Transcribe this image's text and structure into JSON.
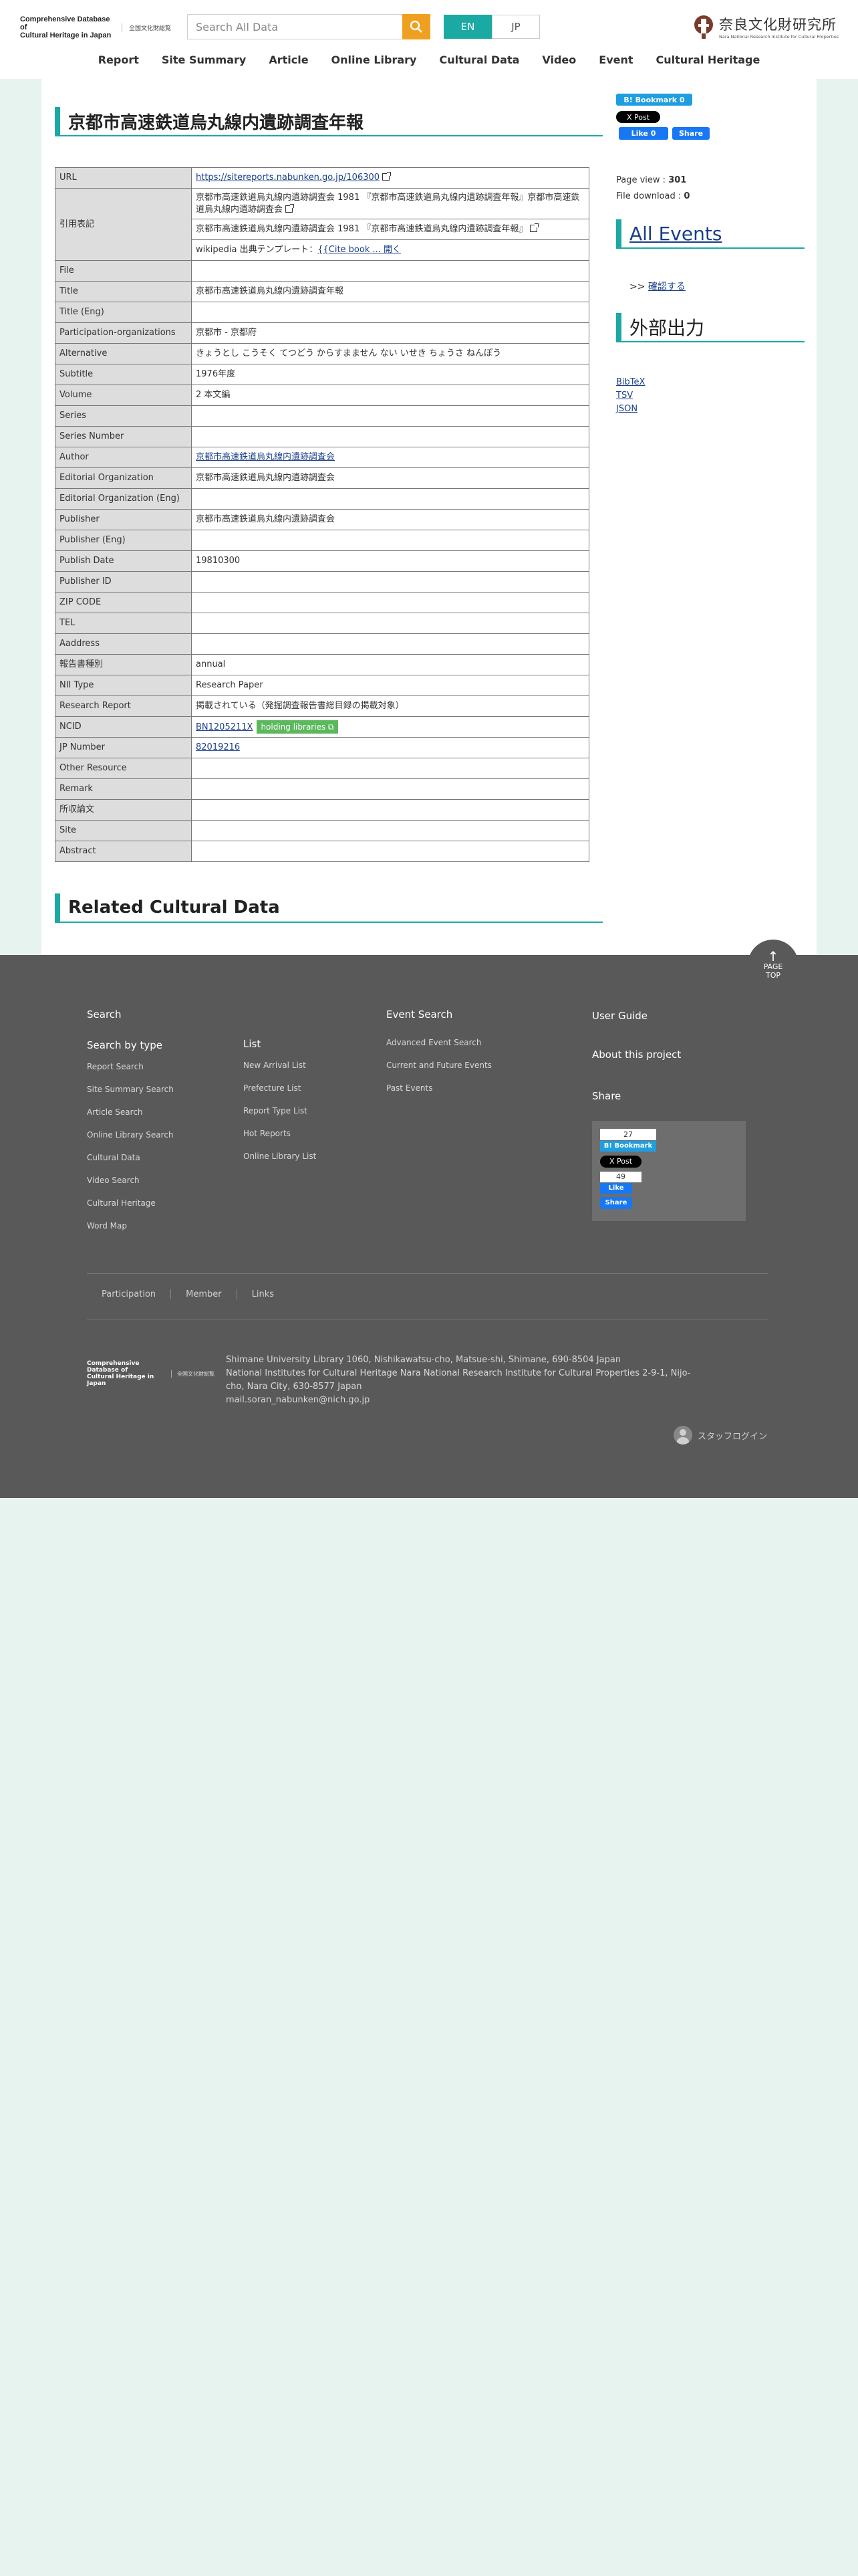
{
  "header": {
    "logo_en_line1": "Comprehensive Database of",
    "logo_en_line2": "Cultural Heritage in Japan",
    "logo_jp": "全国文化財総覧",
    "search_placeholder": "Search All Data",
    "lang_en": "EN",
    "lang_jp": "JP",
    "org_name": "奈良文化財研究所",
    "org_name_en": "Nara National Research Institute for Cultural Properties"
  },
  "nav": [
    "Report",
    "Site Summary",
    "Article",
    "Online Library",
    "Cultural Data",
    "Video",
    "Event",
    "Cultural Heritage"
  ],
  "page_title": "京都市高速鉄道烏丸線内遺跡調査年報",
  "metadata": {
    "url_label": "URL",
    "url_value": "https://sitereports.nabunken.go.jp/106300",
    "citation_label": "引用表記",
    "citation_1": "京都市高速鉄道烏丸線内遺跡調査会 1981 『京都市高速鉄道烏丸線内遺跡調査年報』京都市高速鉄道烏丸線内遺跡調査会",
    "citation_2": "京都市高速鉄道烏丸線内遺跡調査会 1981 『京都市高速鉄道烏丸線内遺跡調査年報』",
    "citation_3_prefix": "wikipedia 出典テンプレート：",
    "citation_3_link": "{{Cite book ... 開く",
    "rows": [
      {
        "label": "File",
        "value": ""
      },
      {
        "label": "Title",
        "value": "京都市高速鉄道烏丸線内遺跡調査年報"
      },
      {
        "label": "Title (Eng)",
        "value": ""
      },
      {
        "label": "Participation-organizations",
        "value": "京都市 - 京都府"
      },
      {
        "label": "Alternative",
        "value": "きょうとし こうそく てつどう からすまません ない いせき ちょうさ ねんぽう"
      },
      {
        "label": "Subtitle",
        "value": "1976年度"
      },
      {
        "label": "Volume",
        "value": "2 本文編"
      },
      {
        "label": "Series",
        "value": ""
      },
      {
        "label": "Series Number",
        "value": ""
      },
      {
        "label": "Author",
        "value": "京都市高速鉄道烏丸線内遺跡調査会",
        "link": true
      },
      {
        "label": "Editorial Organization",
        "value": "京都市高速鉄道烏丸線内遺跡調査会"
      },
      {
        "label": "Editorial Organization (Eng)",
        "value": ""
      },
      {
        "label": "Publisher",
        "value": "京都市高速鉄道烏丸線内遺跡調査会"
      },
      {
        "label": "Publisher (Eng)",
        "value": ""
      },
      {
        "label": "Publish Date",
        "value": "19810300"
      },
      {
        "label": "Publisher ID",
        "value": ""
      },
      {
        "label": "ZIP CODE",
        "value": ""
      },
      {
        "label": "TEL",
        "value": ""
      },
      {
        "label": "Aaddress",
        "value": ""
      },
      {
        "label": "報告書種別",
        "value": "annual"
      },
      {
        "label": "NII Type",
        "value": "Research Paper"
      },
      {
        "label": "Research Report",
        "value": "掲載されている（発掘調査報告書総目録の掲載対象）"
      },
      {
        "label": "NCID",
        "value": "BN1205211X",
        "link": true,
        "badge": "holding libraries"
      },
      {
        "label": "JP Number",
        "value": "82019216",
        "link": true
      },
      {
        "label": "Other Resource",
        "value": ""
      },
      {
        "label": "Remark",
        "value": ""
      },
      {
        "label": "所収論文",
        "value": ""
      },
      {
        "label": "Site",
        "value": ""
      },
      {
        "label": "Abstract",
        "value": ""
      }
    ]
  },
  "related_title": "Related Cultural Data",
  "sidebar": {
    "bookmark": "B! Bookmark 0",
    "xpost": "X Post",
    "like": "Like 0",
    "share": "Share",
    "page_view_label": "Page view : ",
    "page_view": "301",
    "file_download_label": "File download : ",
    "file_download": "0",
    "all_events": "All Events",
    "confirm_prefix": ">> ",
    "confirm": "確認する",
    "export_title": "外部出力",
    "export_links": [
      "BibTeX",
      "TSV",
      "JSON"
    ]
  },
  "footer": {
    "page_top_line1": "PAGE",
    "page_top_line2": "TOP",
    "search": "Search",
    "search_by_type": "Search by type",
    "search_items": [
      "Report Search",
      "Site Summary Search",
      "Article Search",
      "Online Library Search",
      "Cultural Data",
      "Video Search",
      "Cultural Heritage",
      "Word Map"
    ],
    "list": "List",
    "list_items": [
      "New Arrival List",
      "Prefecture List",
      "Report Type List",
      "Hot Reports",
      "Online Library List"
    ],
    "event_search": "Event Search",
    "event_items": [
      "Advanced Event Search",
      "Current and Future Events",
      "Past Events"
    ],
    "user_guide": "User Guide",
    "about": "About this project",
    "share": "Share",
    "share_count": "27",
    "share_bookmark": "B! Bookmark",
    "share_xpost": "X Post",
    "share_like_count": "49",
    "share_like": "Like",
    "share_share": "Share",
    "bottom_links": [
      "Participation",
      "Member",
      "Links"
    ],
    "logo_en_line1": "Comprehensive Database of",
    "logo_en_line2": "Cultural Heritage in Japan",
    "logo_jp": "全国文化財総覧",
    "address_1": "Shimane University Library 1060, Nishikawatsu-cho, Matsue-shi, Shimane, 690-8504 Japan",
    "address_2": "National Institutes for Cultural Heritage Nara National Research Institute for Cultural Properties 2-9-1, Nijo-cho, Nara City, 630-8577 Japan",
    "address_3": "mail.soran_nabunken@nich.go.jp",
    "staff_login": "スタッフログイン"
  }
}
